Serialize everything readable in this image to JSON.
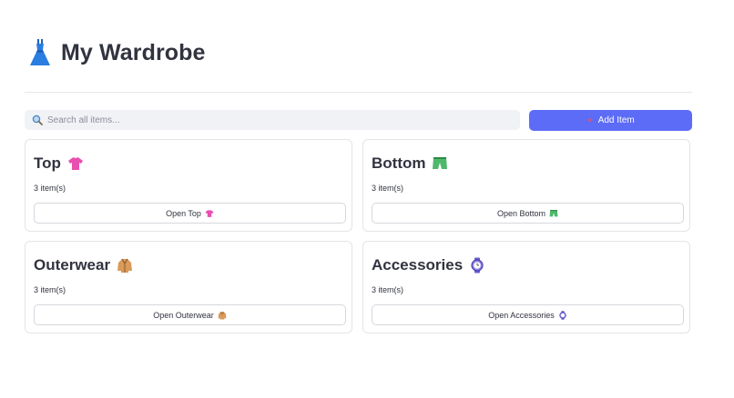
{
  "header": {
    "title": "My Wardrobe",
    "icon": "dress-icon"
  },
  "search": {
    "placeholder": "Search all items...",
    "value": "",
    "icon": "magnifier-icon"
  },
  "add_button": {
    "label": "Add Item",
    "icon": "plus-icon"
  },
  "categories": [
    {
      "name": "Top",
      "icon": "tshirt-icon",
      "count_text": "3 item(s)",
      "button_label": "Open Top",
      "color": "#e94fb0"
    },
    {
      "name": "Bottom",
      "icon": "shorts-icon",
      "count_text": "3 item(s)",
      "button_label": "Open Bottom",
      "color": "#4fb86a"
    },
    {
      "name": "Outerwear",
      "icon": "coat-icon",
      "count_text": "3 item(s)",
      "button_label": "Open Outerwear",
      "color": "#d99a5a"
    },
    {
      "name": "Accessories",
      "icon": "watch-icon",
      "count_text": "3 item(s)",
      "button_label": "Open Accessories",
      "color": "#6a5fd1"
    }
  ],
  "colors": {
    "accent": "#5c6cf6",
    "text": "#31333f",
    "plus": "#ff4b4b"
  }
}
